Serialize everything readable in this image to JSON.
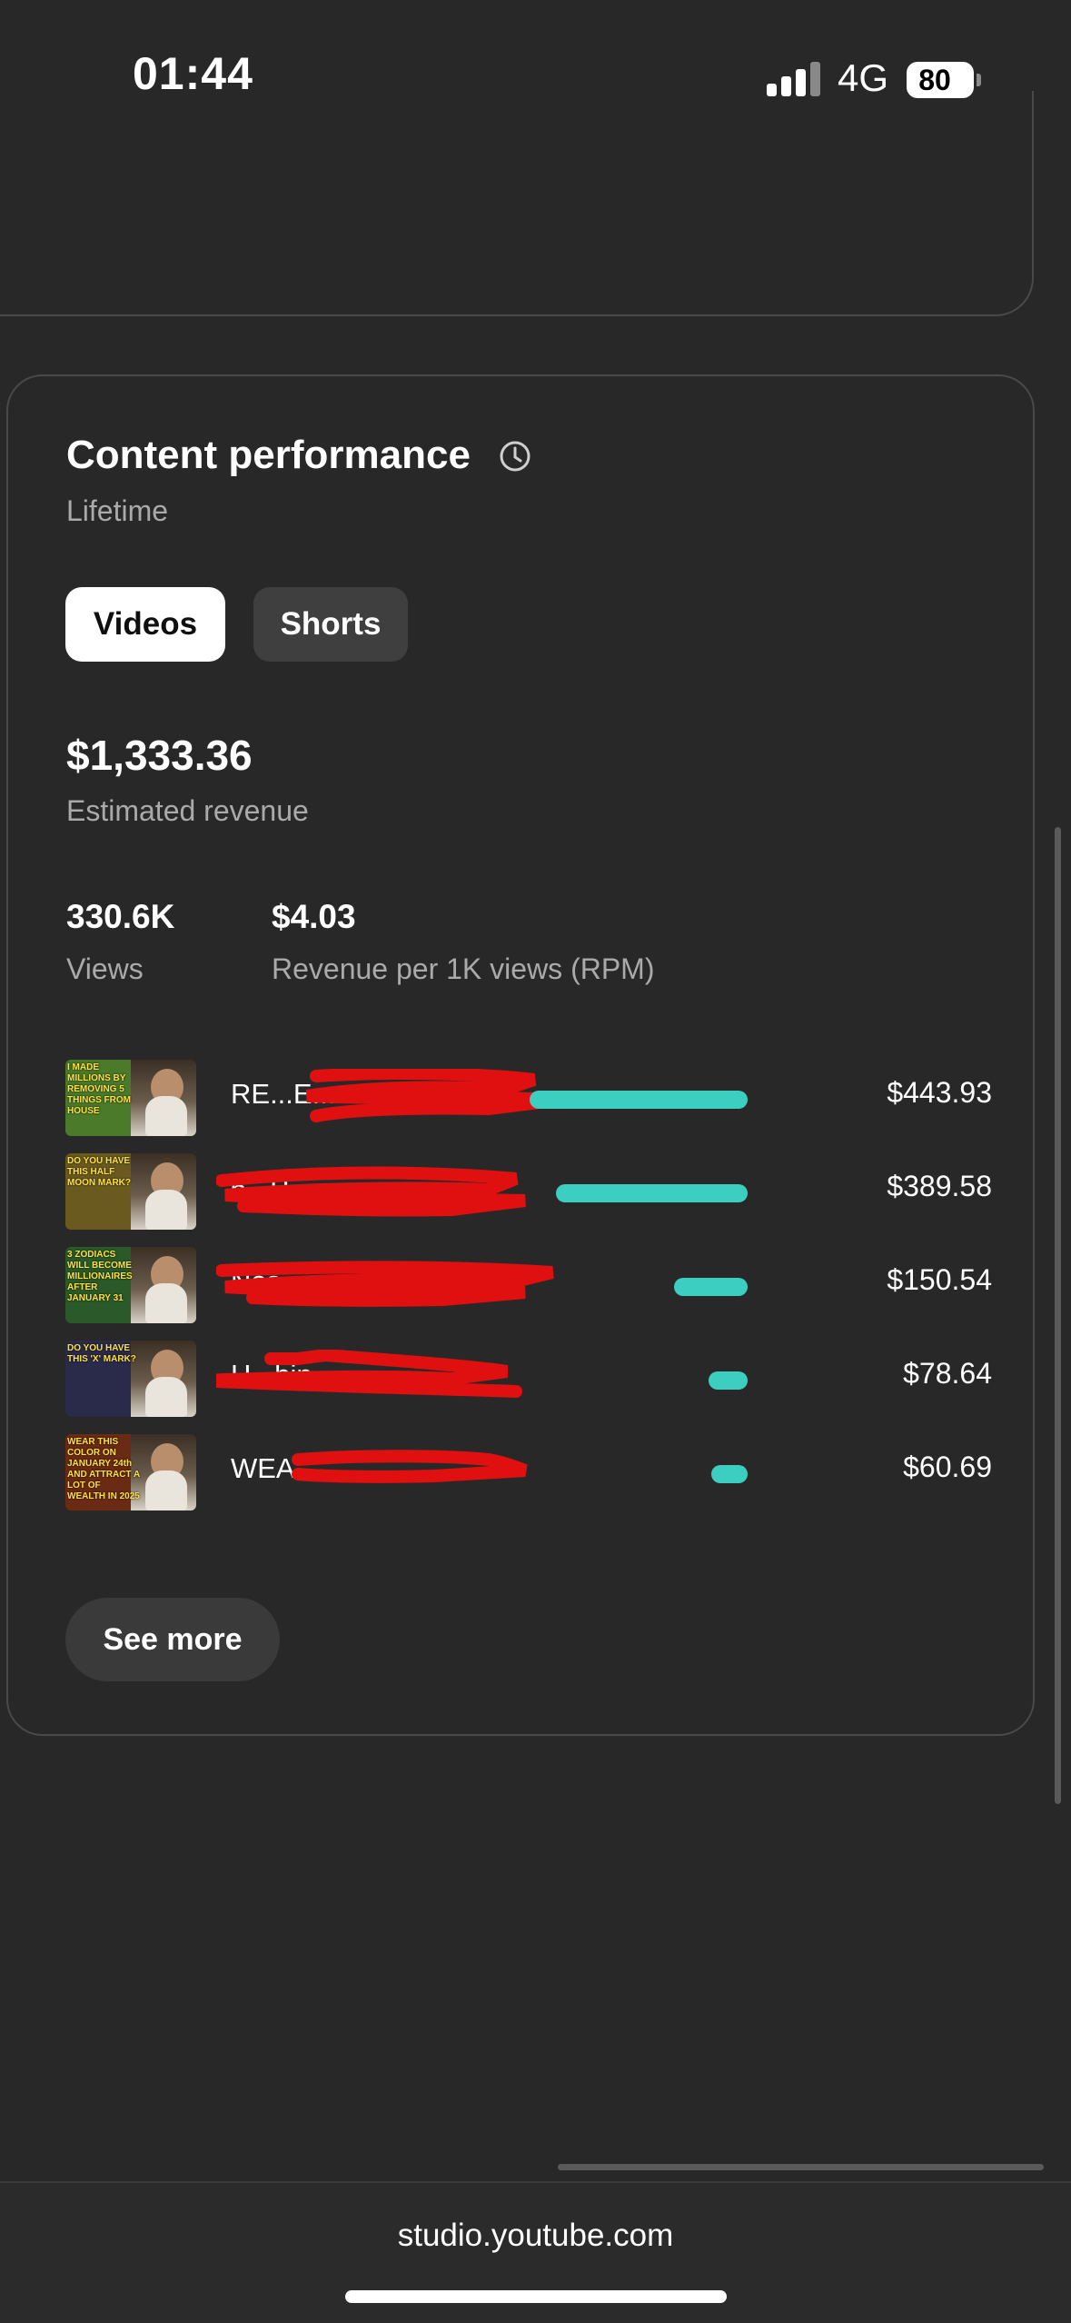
{
  "status_bar": {
    "time": "01:44",
    "network": "4G",
    "battery": "80"
  },
  "card": {
    "title": "Content performance",
    "subtitle": "Lifetime",
    "tabs": [
      {
        "label": "Videos",
        "active": true
      },
      {
        "label": "Shorts",
        "active": false
      }
    ],
    "revenue": {
      "value": "$1,333.36",
      "label": "Estimated revenue"
    },
    "metrics": [
      {
        "value": "330.6K",
        "label": "Views"
      },
      {
        "value": "$4.03",
        "label": "Revenue per 1K views (RPM)"
      }
    ],
    "videos": [
      {
        "title": "RE...E...",
        "amount": "$443.93",
        "revenue": 443.93,
        "thumb_text": "I MADE MILLIONS BY REMOVING 5 THINGS FROM HOUSE",
        "thumb_color": "#4a7a2a"
      },
      {
        "title": "6...P...",
        "amount": "$389.58",
        "revenue": 389.58,
        "thumb_text": "DO YOU HAVE THIS HALF MOON MARK?",
        "thumb_color": "#6a5a20"
      },
      {
        "title": "Nos...",
        "amount": "$150.54",
        "revenue": 150.54,
        "thumb_text": "3 ZODIACS WILL BECOME MILLIONAIRES AFTER JANUARY 31",
        "thumb_color": "#2a5a2a"
      },
      {
        "title": "H...bin...",
        "amount": "$78.64",
        "revenue": 78.64,
        "thumb_text": "DO YOU HAVE THIS 'X' MARK?",
        "thumb_color": "#2a2a4a"
      },
      {
        "title": "WEA...",
        "amount": "$60.69",
        "revenue": 60.69,
        "thumb_text": "WEAR THIS COLOR ON JANUARY 24th AND ATTRACT A LOT OF WEALTH IN 2025",
        "thumb_color": "#6a2a14"
      }
    ],
    "see_more": "See more"
  },
  "url_bar": {
    "url": "studio.youtube.com"
  },
  "colors": {
    "background": "#282828",
    "accent_bar": "#3ccec0",
    "redaction": "#e01010"
  }
}
